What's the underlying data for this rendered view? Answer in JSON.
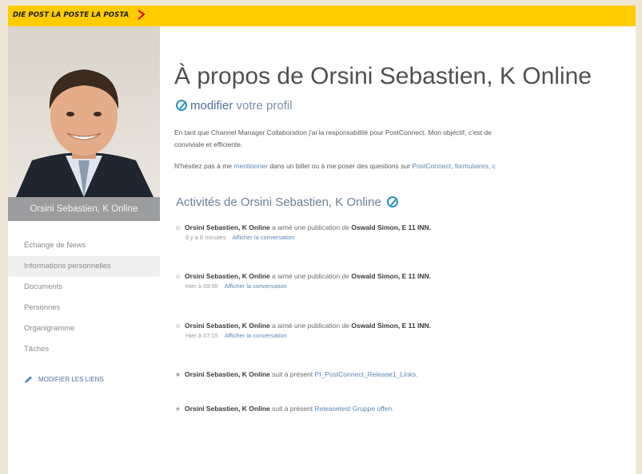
{
  "header": {
    "brand_text": "DIE POST  LA POSTE  LA POSTA"
  },
  "profile": {
    "name": "Orsini Sebastien, K Online"
  },
  "nav": {
    "items": [
      {
        "label": "Échange de News"
      },
      {
        "label": "Informations personnelles"
      },
      {
        "label": "Documents"
      },
      {
        "label": "Personnes"
      },
      {
        "label": "Organigramme"
      },
      {
        "label": "Tâches"
      }
    ],
    "edit_links_label": "MODIFIER LES LIENS"
  },
  "main": {
    "title": "À propos de Orsini Sebastien, K Online",
    "edit_profile_link": "modifier",
    "edit_profile_rest": "votre profil",
    "bio_line1": "En tant que Channel Manager Collaboration j'ai la responsabilité pour PostConnect. Mon objectif, c'est de",
    "bio_line2": "conviviale et efficiente.",
    "bio2_pre": "N'hésitez pas à me ",
    "bio2_link1": "mentionner",
    "bio2_mid": " dans un billet ou à me poser des questions sur ",
    "bio2_link2": "PostConnect, formulaires, c",
    "activities_heading": "Activités de Orsini Sebastien, K Online",
    "activities": [
      {
        "actor": "Orsini Sebastien, K Online",
        "verb": " a aimé une publication de ",
        "target": "Oswald Simon, E 11 INN.",
        "time": "Il y a 8 minutes",
        "action": "Afficher la conversation"
      },
      {
        "actor": "Orsini Sebastien, K Online",
        "verb": " a aimé une publication de ",
        "target": "Oswald Simon, E 11 INN.",
        "time": "Hier à 09:55",
        "action": "Afficher la conversation"
      },
      {
        "actor": "Orsini Sebastien, K Online",
        "verb": " a aimé une publication de ",
        "target": "Oswald Simon, E 11 INN.",
        "time": "Hier à 07:15",
        "action": "Afficher la conversation"
      },
      {
        "actor": "Orsini Sebastien, K Online",
        "verb": " suit à présent ",
        "target": "PI_PostConnect_Release1_Links."
      },
      {
        "actor": "Orsini Sebastien, K Online",
        "verb": " suit à présent ",
        "target": "Releasetest Gruppe offen."
      }
    ]
  },
  "colors": {
    "header_yellow": "#ffcc00",
    "link_blue": "#5a86b5",
    "icon_blue": "#2a8fc8"
  }
}
